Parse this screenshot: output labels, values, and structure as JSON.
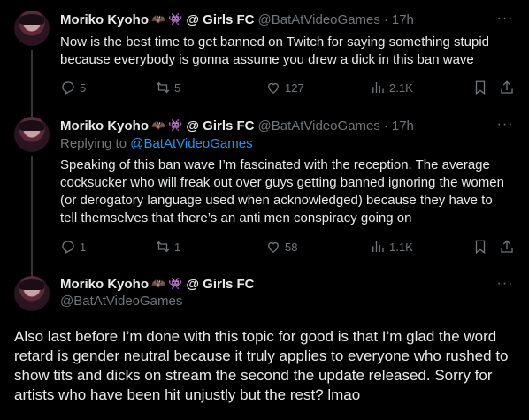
{
  "tweets": [
    {
      "name": "Moriko Kyoho",
      "team": "@ Girls FC",
      "handle": "@BatAtVideoGames",
      "time": "17h",
      "text": "Now is the best time to get banned on Twitch for saying something stupid because everybody is gonna assume you drew a dick in this ban wave",
      "replies": "5",
      "reposts": "5",
      "likes": "127",
      "views": "2.1K"
    },
    {
      "name": "Moriko Kyoho",
      "team": "@ Girls FC",
      "handle": "@BatAtVideoGames",
      "time": "17h",
      "replying_prefix": "Replying to",
      "replying_to": "@BatAtVideoGames",
      "text": "Speaking of this ban wave I’m fascinated with the reception. The average cocksucker who will freak out over guys getting banned ignoring the women (or derogatory language used when acknowledged) because they have to tell themselves that there’s an anti men conspiracy going on",
      "replies": "1",
      "reposts": "1",
      "likes": "58",
      "views": "1.1K"
    },
    {
      "name": "Moriko Kyoho",
      "team": "@ Girls FC",
      "handle": "@BatAtVideoGames",
      "text": "Also last before I’m done with this topic for good is that I’m glad the word retard is gender neutral because it truly applies to everyone who rushed to show tits and dicks on stream the second the update released. Sorry for artists who have been hit unjustly but the rest? lmao"
    }
  ],
  "ui": {
    "dot": "·",
    "more": "···"
  },
  "icons": [
    "reply-icon",
    "repost-icon",
    "like-icon",
    "views-icon",
    "bookmark-icon",
    "share-icon",
    "more-icon"
  ],
  "colors": {
    "background": "#000000",
    "text": "#e7e9ea",
    "muted": "#71767b",
    "link": "#1d9bf0",
    "divider": "#2f3336"
  }
}
